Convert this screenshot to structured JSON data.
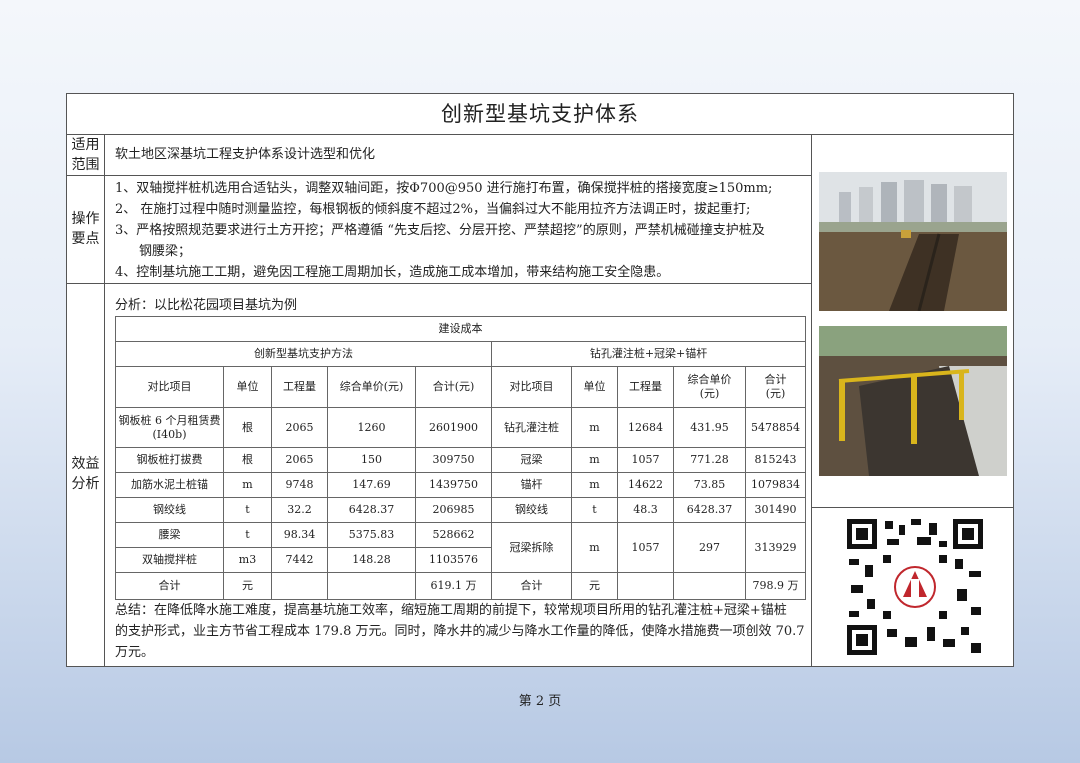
{
  "title": "创新型基坑支护体系",
  "scope": {
    "label_line1": "适用",
    "label_line2": "范围",
    "text": "软土地区深基坑工程支护体系设计选型和优化"
  },
  "operation": {
    "label_line1": "操作",
    "label_line2": "要点",
    "points": [
      "1、双轴搅拌桩机选用合适钻头，调整双轴间距，按Φ700@950 进行施打布置，确保搅拌桩的搭接宽度≥150mm;",
      "2、 在施打过程中随时测量监控，每根钢板的倾斜度不超过2%，当偏斜过大不能用拉齐方法调正时，拔起重打;",
      "3、严格按照规范要求进行土方开挖；严格遵循 “先支后挖、分层开挖、严禁超挖”的原则，严禁机械碰撞支护桩及",
      "钢腰梁；",
      "4、控制基坑施工工期，避免因工程施工周期加长，造成施工成本增加，带来结构施工安全隐患。"
    ]
  },
  "benefit": {
    "label_line1": "效益",
    "label_line2": "分析",
    "intro": "分析：以比松花园项目基坑为例",
    "summary": [
      "总结：在降低降水施工难度，提高基坑施工效率，缩短施工周期的前提下，较常规项目所用的钻孔灌注桩+冠梁+锚桩",
      "的支护形式，业主方节省工程成本 179.8 万元。同时，降水井的减少与降水工作量的降低，使降水措施费一项创效 70.7",
      "万元。"
    ]
  },
  "cost_table": {
    "caption": "建设成本",
    "left_header": "创新型基坑支护方法",
    "right_header": "钻孔灌注桩+冠梁+锚杆",
    "columns": [
      "对比项目",
      "单位",
      "工程量",
      "综合单价(元)",
      "合计(元)",
      "对比项目",
      "单位",
      "工程量",
      "综合单价\n(元)",
      "合计\n(元)"
    ],
    "rows": [
      [
        "钢板桩 6 个月租赁费(I40b)",
        "根",
        "2065",
        "1260",
        "2601900",
        "钻孔灌注桩",
        "m",
        "12684",
        "431.95",
        "5478854"
      ],
      [
        "钢板桩打拔费",
        "根",
        "2065",
        "150",
        "309750",
        "冠梁",
        "m",
        "1057",
        "771.28",
        "815243"
      ],
      [
        "加筋水泥土桩锚",
        "m",
        "9748",
        "147.69",
        "1439750",
        "锚杆",
        "m",
        "14622",
        "73.85",
        "1079834"
      ],
      [
        "钢绞线",
        "t",
        "32.2",
        "6428.37",
        "206985",
        "钢绞线",
        "t",
        "48.3",
        "6428.37",
        "301490"
      ],
      [
        "腰梁",
        "t",
        "98.34",
        "5375.83",
        "528662",
        "冠梁拆除",
        "m",
        "1057",
        "297",
        "313929"
      ],
      [
        "双轴搅拌桩",
        "m3",
        "7442",
        "148.28",
        "1103576"
      ],
      [
        "合计",
        "元",
        "",
        "",
        "619.1 万",
        "合计",
        "元",
        "",
        "",
        "798.9 万"
      ]
    ]
  },
  "page_number": "第 2 页",
  "colors": {
    "accent": "#c0272d",
    "page_bg_bottom": "#b7c9e4"
  }
}
